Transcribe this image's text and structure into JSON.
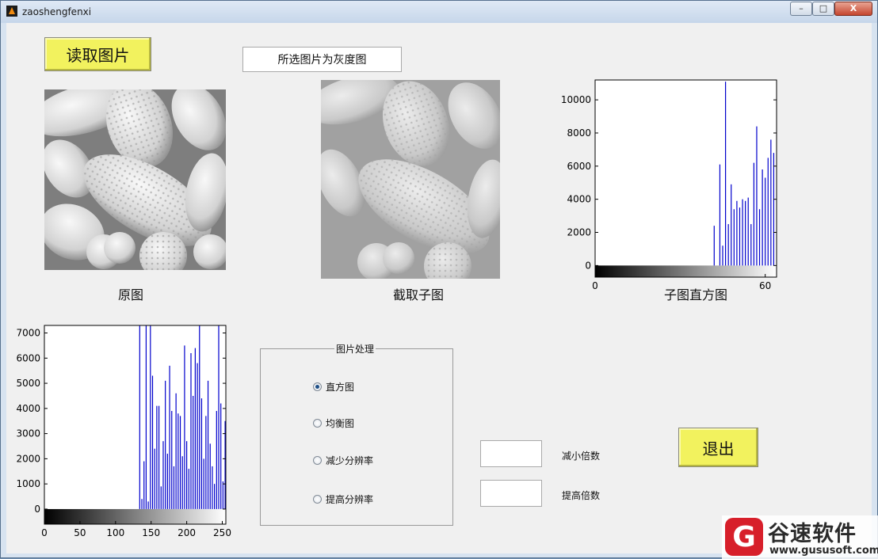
{
  "window": {
    "title": "zaoshengfenxi",
    "minimize": "–",
    "maximize": "□",
    "close": "X"
  },
  "buttons": {
    "read_image": "读取图片",
    "exit": "退出"
  },
  "status_text": "所选图片为灰度图",
  "captions": {
    "original": "原图",
    "cropped": "截取子图",
    "sub_histogram": "子图直方图"
  },
  "panel": {
    "title": "图片处理",
    "options": [
      {
        "label": "直方图",
        "selected": true
      },
      {
        "label": "均衡图",
        "selected": false
      },
      {
        "label": "减少分辨率",
        "selected": false
      },
      {
        "label": "提高分辨率",
        "selected": false
      }
    ]
  },
  "fields": {
    "reduce_label": "减小倍数",
    "reduce_value": "",
    "increase_label": "提高倍数",
    "increase_value": ""
  },
  "watermark": {
    "logo_letter": "G",
    "title": "谷速软件",
    "url": "www.gususoft.com"
  },
  "colors": {
    "button_yellow": "#f2f25e",
    "bar_blue": "#0000cc",
    "window_bg": "#f0f0f0"
  },
  "chart_data": [
    {
      "type": "bar",
      "title": "",
      "xlabel": "",
      "ylabel": "",
      "xlim": [
        0,
        64
      ],
      "ylim": [
        -700,
        11200
      ],
      "yticks": [
        0,
        2000,
        4000,
        6000,
        8000,
        10000
      ],
      "xticks": [
        0,
        60
      ],
      "x": [
        42,
        44,
        45,
        46,
        47,
        48,
        49,
        50,
        51,
        52,
        53,
        54,
        55,
        56,
        57,
        58,
        59,
        60,
        61,
        62,
        63
      ],
      "values": [
        2400,
        6100,
        1200,
        11100,
        2500,
        4900,
        3400,
        3900,
        3500,
        4000,
        3900,
        4100,
        2500,
        6200,
        8400,
        3400,
        5800,
        5300,
        6500,
        7600,
        6800
      ]
    },
    {
      "type": "bar",
      "title": "",
      "xlabel": "",
      "ylabel": "",
      "xlim": [
        0,
        255
      ],
      "ylim": [
        -600,
        7300
      ],
      "yticks": [
        0,
        1000,
        2000,
        3000,
        4000,
        5000,
        6000,
        7000
      ],
      "xticks": [
        0,
        50,
        100,
        150,
        200,
        250
      ],
      "x": [
        134,
        137,
        140,
        143,
        146,
        149,
        152,
        155,
        158,
        161,
        164,
        167,
        170,
        173,
        176,
        179,
        182,
        185,
        188,
        191,
        194,
        197,
        200,
        203,
        206,
        209,
        212,
        215,
        218,
        221,
        224,
        227,
        230,
        233,
        236,
        239,
        242,
        245,
        248,
        251,
        254
      ],
      "values": [
        7300,
        400,
        1900,
        7300,
        300,
        7300,
        5300,
        2400,
        4100,
        4100,
        900,
        2700,
        5100,
        2200,
        5700,
        3900,
        1700,
        4600,
        3800,
        3700,
        2100,
        6500,
        2700,
        1600,
        6200,
        4500,
        6400,
        5800,
        7300,
        4400,
        2000,
        3700,
        5100,
        2600,
        1700,
        1000,
        3900,
        7300,
        4200,
        1100,
        3500
      ]
    }
  ]
}
